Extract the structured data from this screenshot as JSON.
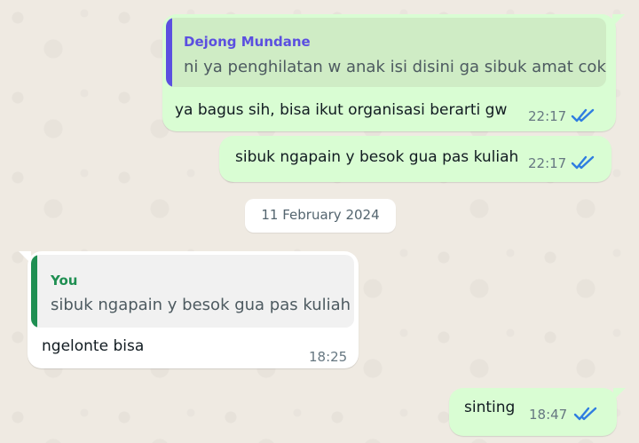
{
  "chat": {
    "messages": [
      {
        "direction": "outgoing",
        "quote": {
          "author": "Dejong Mundane",
          "text": "ni ya penghilatan w anak isi disini ga sibuk amat cok",
          "author_color": "#5b4fe0",
          "bar_color": "#5b4fe0"
        },
        "text": "ya bagus sih, bisa ikut organisasi berarti gw",
        "time": "22:17",
        "status_icon": "double-check-read-icon"
      },
      {
        "direction": "outgoing",
        "text": "sibuk ngapain y besok gua pas kuliah",
        "time": "22:17",
        "status_icon": "double-check-read-icon"
      },
      {
        "direction": "separator",
        "date": "11 February 2024"
      },
      {
        "direction": "incoming",
        "quote": {
          "author": "You",
          "text": "sibuk ngapain y besok gua pas kuliah",
          "author_color": "#1f8f52",
          "bar_color": "#1f8f52"
        },
        "text": "ngelonte bisa",
        "time": "18:25"
      },
      {
        "direction": "outgoing",
        "text": "sinting",
        "time": "18:47",
        "status_icon": "double-check-read-icon"
      }
    ]
  },
  "colors": {
    "background": "#efeae2",
    "outgoing_bubble": "#d9fdd3",
    "incoming_bubble": "#ffffff",
    "read_check": "#2f7de1"
  }
}
